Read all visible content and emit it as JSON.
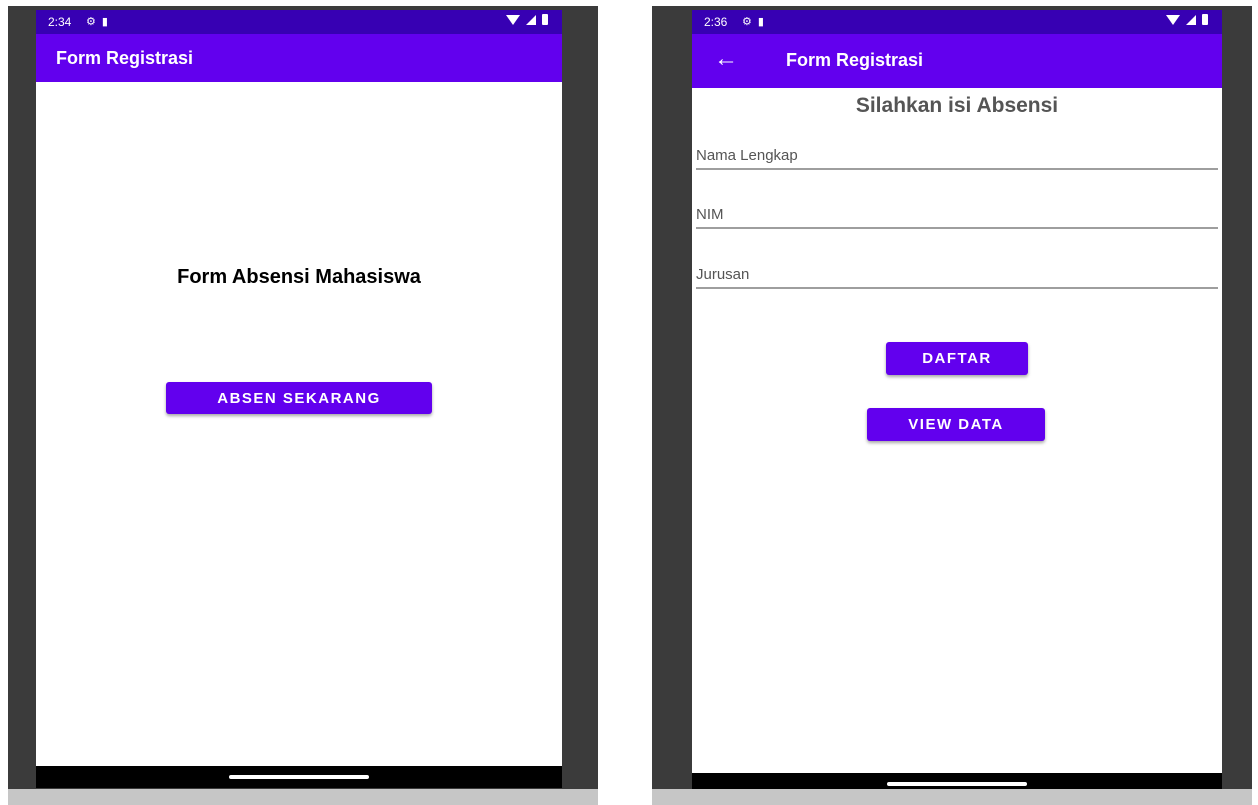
{
  "left_screen": {
    "status_time": "2:34",
    "app_title": "Form Registrasi",
    "heading": "Form Absensi Mahasiswa",
    "absen_button_label": "ABSEN SEKARANG"
  },
  "right_screen": {
    "status_time": "2:36",
    "app_title": "Form Registrasi",
    "heading": "Silahkan isi Absensi",
    "fields": {
      "nama_placeholder": "Nama Lengkap",
      "nim_placeholder": "NIM",
      "jurusan_placeholder": "Jurusan"
    },
    "daftar_button_label": "DAFTAR",
    "view_button_label": "VIEW DATA"
  },
  "icons": {
    "status_left": [
      "gear-icon",
      "sd-card-icon"
    ],
    "status_right": [
      "wifi-icon",
      "signal-icon",
      "battery-icon"
    ],
    "back": "arrow-left-icon"
  },
  "colors": {
    "status_bar": "#3700b3",
    "app_bar": "#6200ee",
    "button": "#6200ee",
    "bezel": "#3b3b3b"
  }
}
